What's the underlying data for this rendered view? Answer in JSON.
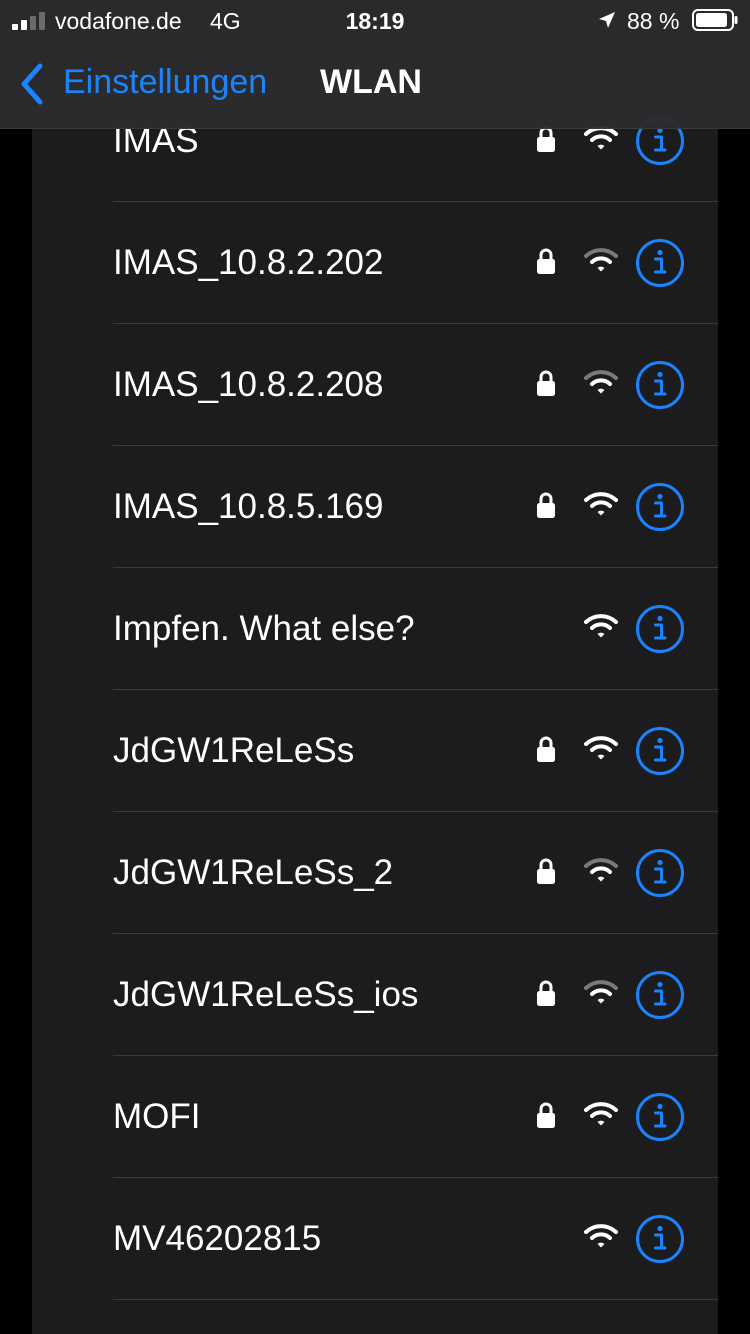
{
  "status_bar": {
    "carrier": "vodafone.de",
    "network": "4G",
    "time": "18:19",
    "battery": "88 %"
  },
  "nav": {
    "back_label": "Einstellungen",
    "title": "WLAN"
  },
  "colors": {
    "accent": "#1a84ff",
    "background": "#000000",
    "card": "#1c1c1e"
  },
  "networks": [
    {
      "name": "IMAS",
      "secured": true,
      "strength": "strong"
    },
    {
      "name": "IMAS_10.8.2.202",
      "secured": true,
      "strength": "medium"
    },
    {
      "name": "IMAS_10.8.2.208",
      "secured": true,
      "strength": "medium"
    },
    {
      "name": "IMAS_10.8.5.169",
      "secured": true,
      "strength": "strong"
    },
    {
      "name": "Impfen. What else?",
      "secured": false,
      "strength": "strong"
    },
    {
      "name": "JdGW1ReLeSs",
      "secured": true,
      "strength": "strong"
    },
    {
      "name": "JdGW1ReLeSs_2",
      "secured": true,
      "strength": "medium"
    },
    {
      "name": "JdGW1ReLeSs_ios",
      "secured": true,
      "strength": "medium"
    },
    {
      "name": "MOFI",
      "secured": true,
      "strength": "strong"
    },
    {
      "name": "MV46202815",
      "secured": false,
      "strength": "strong"
    }
  ]
}
